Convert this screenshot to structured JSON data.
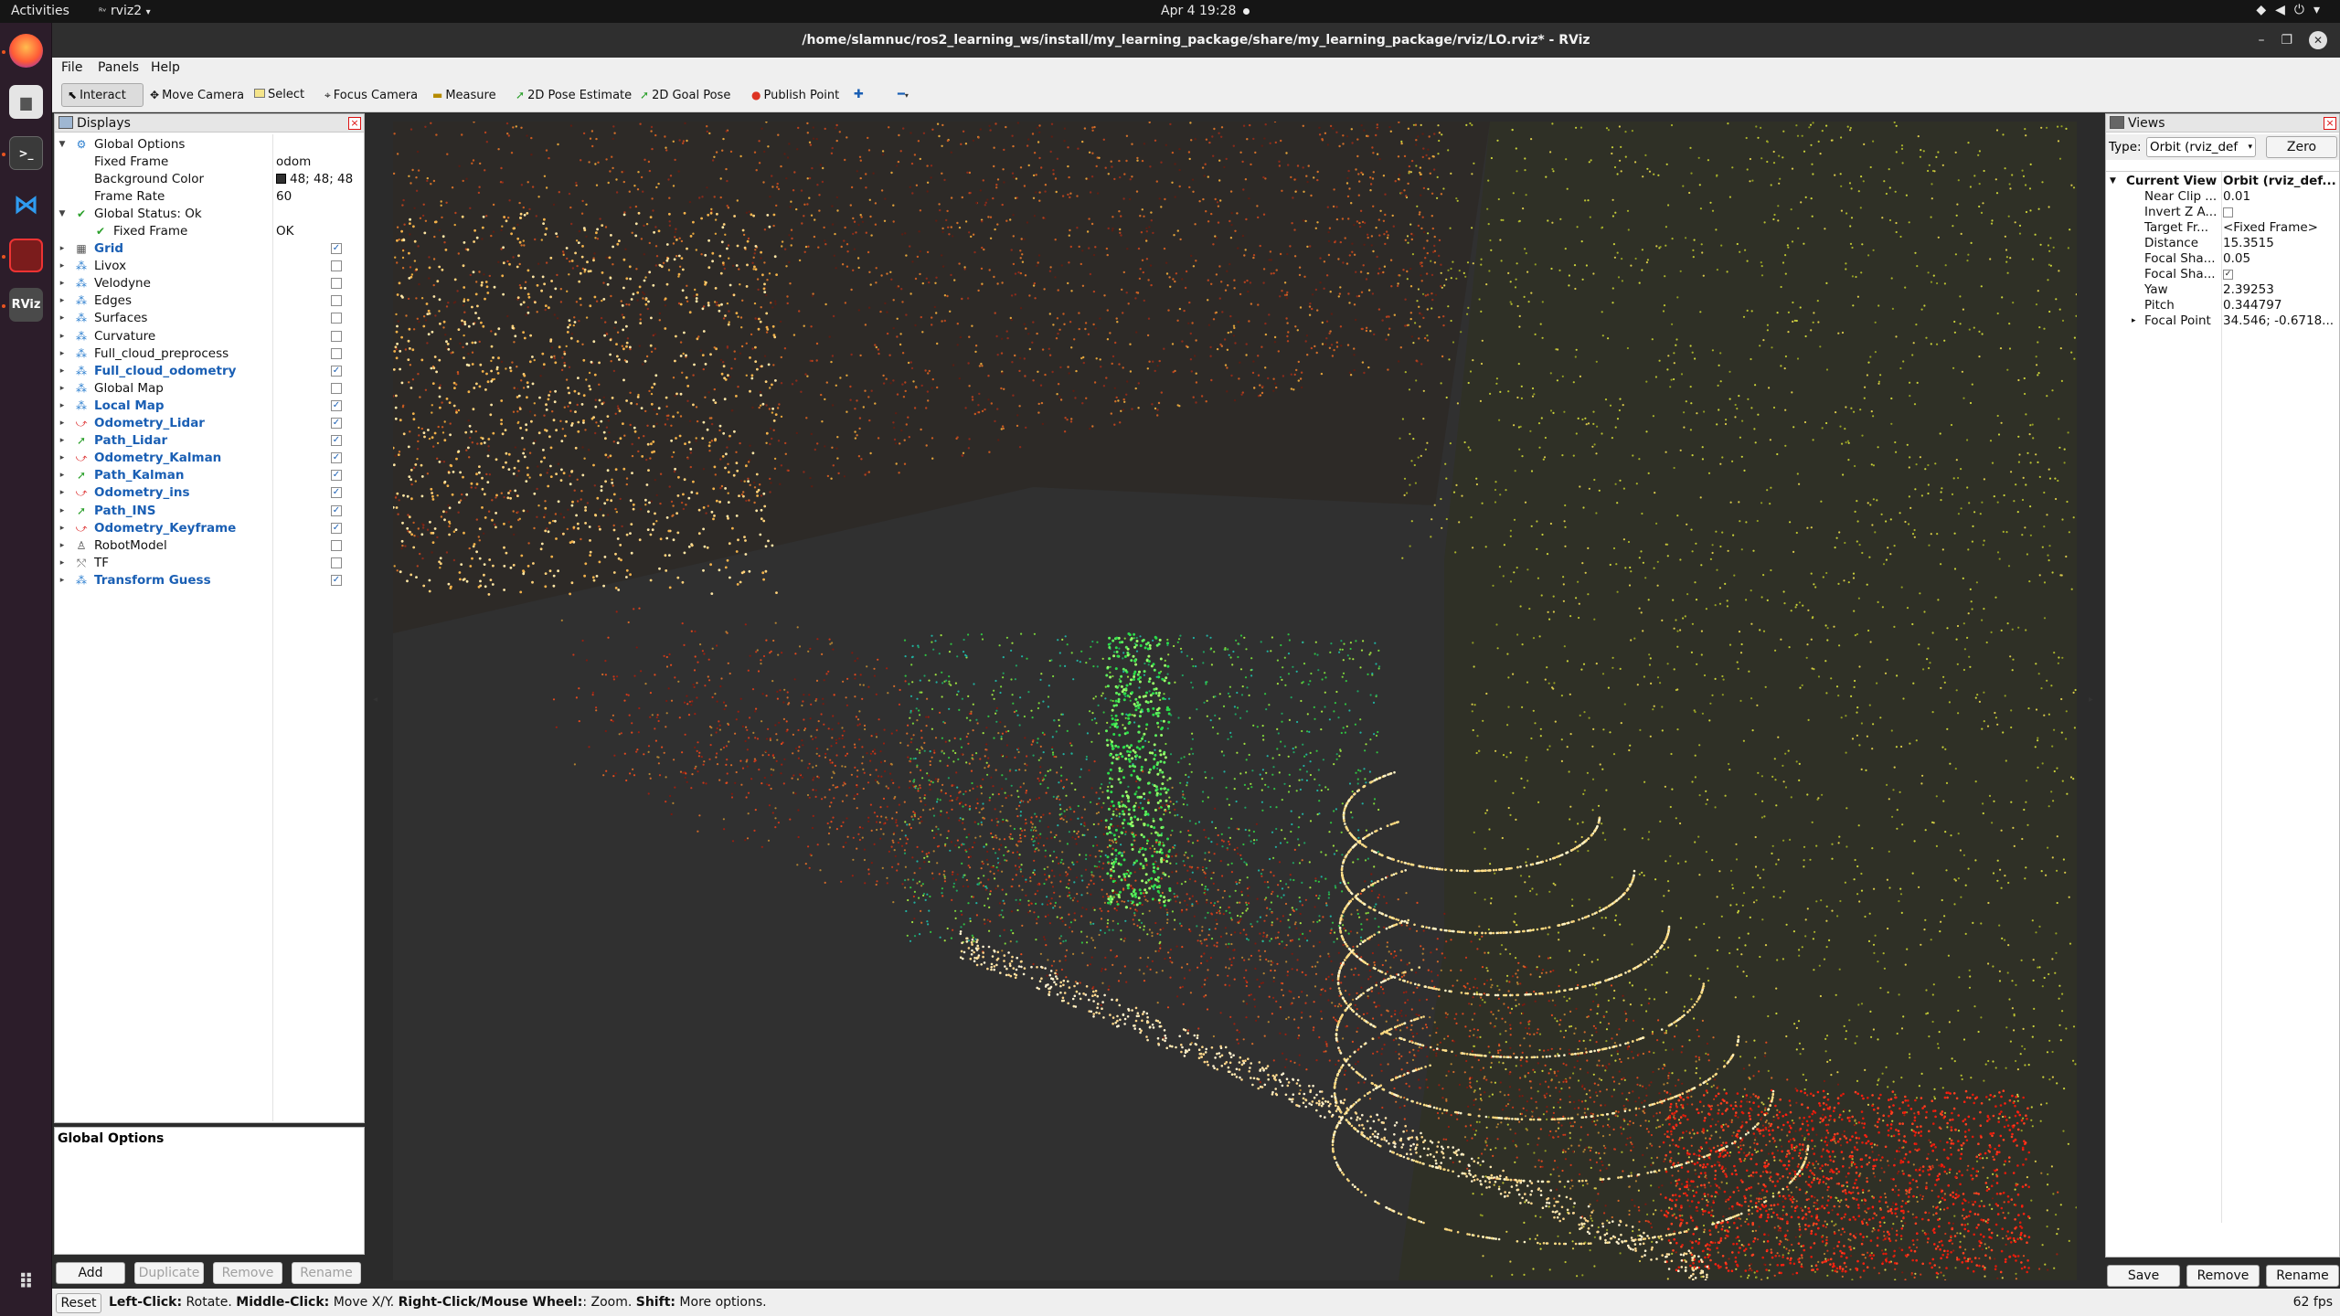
{
  "system": {
    "activities": "Activities",
    "app_name": "rviz2",
    "clock": "Apr 4  19:28",
    "tray_icons": [
      "wifi-icon",
      "speaker-icon",
      "power-icon",
      "chevron-down-icon"
    ]
  },
  "dock": {
    "items": [
      "Firefox",
      "Files",
      "Terminal",
      "Visual Studio Code",
      "Screenshot",
      "RViz"
    ],
    "apps_grid_icon": "apps-grid-icon"
  },
  "window": {
    "title": "/home/slamnuc/ros2_learning_ws/install/my_learning_package/share/my_learning_package/rviz/LO.rviz* - RViz"
  },
  "menu": {
    "file": "File",
    "panels": "Panels",
    "help": "Help"
  },
  "toolbar": {
    "interact": "Interact",
    "move_camera": "Move Camera",
    "select": "Select",
    "focus_camera": "Focus Camera",
    "measure": "Measure",
    "pose_estimate": "2D Pose Estimate",
    "goal_pose": "2D Goal Pose",
    "publish_point": "Publish Point"
  },
  "displays": {
    "title": "Displays",
    "global_options": {
      "label": "Global Options",
      "fixed_frame_key": "Fixed Frame",
      "fixed_frame_val": "odom",
      "bg_color_key": "Background Color",
      "bg_color_val": "48; 48; 48",
      "bg_color_hex": "#303030",
      "frame_rate_key": "Frame Rate",
      "frame_rate_val": "60"
    },
    "global_status": {
      "label": "Global Status: Ok",
      "fixed_frame_key": "Fixed Frame",
      "fixed_frame_val": "OK"
    },
    "items": [
      {
        "label": "Grid",
        "icon": "grid-icon",
        "checked": true,
        "bold": true
      },
      {
        "label": "Livox",
        "icon": "pointcloud-icon",
        "checked": false,
        "bold": false
      },
      {
        "label": "Velodyne",
        "icon": "pointcloud-icon",
        "checked": false,
        "bold": false
      },
      {
        "label": "Edges",
        "icon": "pointcloud-icon",
        "checked": false,
        "bold": false
      },
      {
        "label": "Surfaces",
        "icon": "pointcloud-icon",
        "checked": false,
        "bold": false
      },
      {
        "label": "Curvature",
        "icon": "pointcloud-icon",
        "checked": false,
        "bold": false
      },
      {
        "label": "Full_cloud_preprocess",
        "icon": "pointcloud-icon",
        "checked": false,
        "bold": false
      },
      {
        "label": "Full_cloud_odometry",
        "icon": "pointcloud-icon",
        "checked": true,
        "bold": true
      },
      {
        "label": "Global Map",
        "icon": "pointcloud-icon",
        "checked": false,
        "bold": false
      },
      {
        "label": "Local Map",
        "icon": "pointcloud-icon",
        "checked": true,
        "bold": true
      },
      {
        "label": "Odometry_Lidar",
        "icon": "odometry-icon",
        "checked": true,
        "bold": true
      },
      {
        "label": "Path_Lidar",
        "icon": "path-icon",
        "checked": true,
        "bold": true
      },
      {
        "label": "Odometry_Kalman",
        "icon": "odometry-icon",
        "checked": true,
        "bold": true
      },
      {
        "label": "Path_Kalman",
        "icon": "path-icon",
        "checked": true,
        "bold": true
      },
      {
        "label": "Odometry_ins",
        "icon": "odometry-icon",
        "checked": true,
        "bold": true
      },
      {
        "label": "Path_INS",
        "icon": "path-icon",
        "checked": true,
        "bold": true
      },
      {
        "label": "Odometry_Keyframe",
        "icon": "odometry-icon",
        "checked": true,
        "bold": true
      },
      {
        "label": "RobotModel",
        "icon": "robot-icon",
        "checked": false,
        "bold": false
      },
      {
        "label": "TF",
        "icon": "tf-icon",
        "checked": false,
        "bold": false
      },
      {
        "label": "Transform Guess",
        "icon": "pointcloud-icon",
        "checked": true,
        "bold": true
      }
    ],
    "description_title": "Global Options",
    "buttons": {
      "add": "Add",
      "duplicate": "Duplicate",
      "remove": "Remove",
      "rename": "Rename"
    }
  },
  "views": {
    "title": "Views",
    "type_label": "Type:",
    "type_value": "Orbit (rviz_def",
    "zero": "Zero",
    "current_view_key": "Current View",
    "current_view_val": "Orbit (rviz_def...",
    "props": [
      {
        "k": "Near Clip ...",
        "v": "0.01",
        "cb": false
      },
      {
        "k": "Invert Z A...",
        "v": "",
        "cb": true,
        "checked": false
      },
      {
        "k": "Target Fr...",
        "v": "<Fixed Frame>",
        "cb": false
      },
      {
        "k": "Distance",
        "v": "15.3515",
        "cb": false
      },
      {
        "k": "Focal Sha...",
        "v": "0.05",
        "cb": false
      },
      {
        "k": "Focal Sha...",
        "v": "",
        "cb": true,
        "checked": true
      },
      {
        "k": "Yaw",
        "v": "2.39253",
        "cb": false
      },
      {
        "k": "Pitch",
        "v": "0.344797",
        "cb": false
      },
      {
        "k": "Focal Point",
        "v": "34.546; -0.6718...",
        "cb": false,
        "expandable": true
      }
    ],
    "buttons": {
      "save": "Save",
      "remove": "Remove",
      "rename": "Rename"
    }
  },
  "status": {
    "reset": "Reset",
    "hint_lc": "Left-Click:",
    "hint_lc_t": " Rotate. ",
    "hint_mc": "Middle-Click:",
    "hint_mc_t": " Move X/Y. ",
    "hint_rc": "Right-Click/Mouse Wheel:",
    "hint_rc_t": ": Zoom. ",
    "hint_sh": "Shift:",
    "hint_sh_t": " More options.",
    "fps": "62 fps"
  }
}
